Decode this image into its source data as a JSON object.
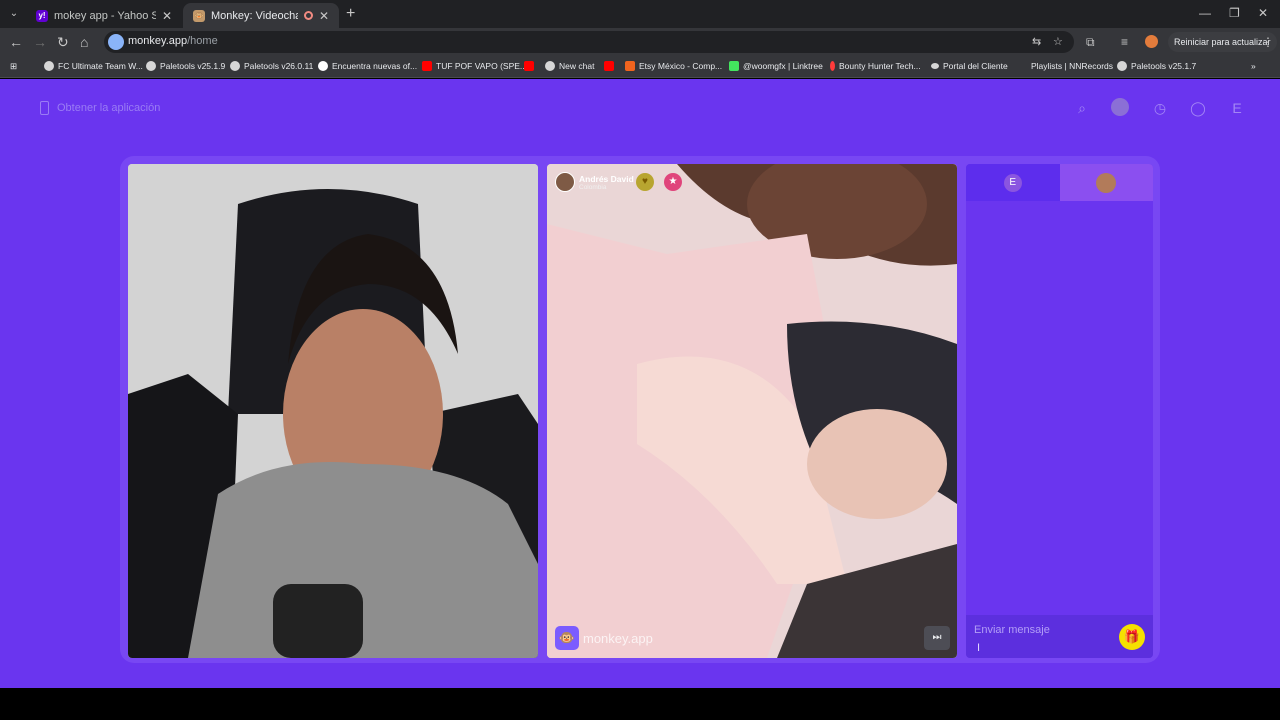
{
  "browser": {
    "tabs": [
      {
        "title": "mokey app - Yahoo Search Tus",
        "favicon": "yahoo-icon"
      },
      {
        "title": "Monkey: Videochat en vivo",
        "favicon": "monkey-icon",
        "recording": true
      }
    ],
    "url_host": "monkey.app",
    "url_path": "/home",
    "relaunch_label": "Reiniciar para actualizar",
    "bookmarks": [
      {
        "label": "FC Ultimate Team W...",
        "color": "#d6d6d6"
      },
      {
        "label": "Paletools v25.1.9",
        "color": "#d6d6d6"
      },
      {
        "label": "Paletools v26.0.11",
        "color": "#d6d6d6"
      },
      {
        "label": "Encuentra nuevas of...",
        "color": "#ffffff"
      },
      {
        "label": "TUF POF VAPO (SPE...",
        "color": "#ff0000"
      },
      {
        "label": "",
        "color": "#ff0000"
      },
      {
        "label": "New chat",
        "color": "#d6d6d6"
      },
      {
        "label": "",
        "color": "#ff0000"
      },
      {
        "label": "Etsy México - Comp...",
        "color": "#f1641e"
      },
      {
        "label": "@woomgfx | Linktree",
        "color": "#43e55e"
      },
      {
        "label": "Bounty Hunter Tech...",
        "color": "#ff3b3b"
      },
      {
        "label": "Portal del Cliente",
        "color": "#d6d6d6"
      },
      {
        "label": "Playlists | NNRecords",
        "color": "#35363a"
      },
      {
        "label": "Paletools v25.1.7",
        "color": "#d6d6d6"
      }
    ]
  },
  "page": {
    "get_app_label": "Obtener la aplicación",
    "top_icons": [
      "search-icon",
      "avatar",
      "history-icon",
      "chat-icon",
      "profile-e-icon"
    ],
    "profile_initial": "E"
  },
  "peer": {
    "name": "Andrés David",
    "country": "Colombia"
  },
  "brand": {
    "name": "monkey.app"
  },
  "chat": {
    "self_initial": "E",
    "placeholder": "Enviar mensaje"
  }
}
